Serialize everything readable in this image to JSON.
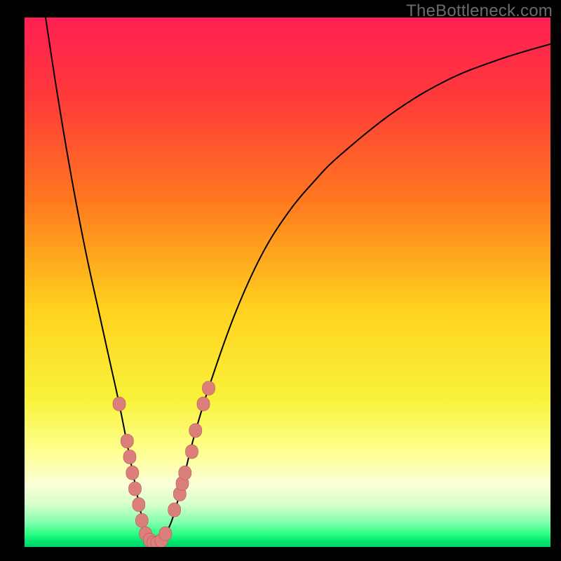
{
  "watermark": "TheBottleneck.com",
  "gradient_stops": [
    {
      "offset": 0.0,
      "color": "#ff1f53"
    },
    {
      "offset": 0.15,
      "color": "#ff3a3a"
    },
    {
      "offset": 0.35,
      "color": "#ff7a1f"
    },
    {
      "offset": 0.55,
      "color": "#ffd21e"
    },
    {
      "offset": 0.72,
      "color": "#f9f23a"
    },
    {
      "offset": 0.82,
      "color": "#feff8f"
    },
    {
      "offset": 0.88,
      "color": "#fbffd7"
    },
    {
      "offset": 0.92,
      "color": "#d6ffca"
    },
    {
      "offset": 0.955,
      "color": "#7dffad"
    },
    {
      "offset": 0.975,
      "color": "#2cff84"
    },
    {
      "offset": 0.99,
      "color": "#00e46f"
    },
    {
      "offset": 1.0,
      "color": "#00d469"
    }
  ],
  "chart_data": {
    "type": "line",
    "title": "",
    "xlabel": "",
    "ylabel": "",
    "xlim": [
      0,
      100
    ],
    "ylim": [
      0,
      100
    ],
    "legend": false,
    "grid": false,
    "series": [
      {
        "name": "curve",
        "x": [
          4,
          6,
          8,
          10,
          12,
          14,
          16,
          18,
          20,
          21,
          22,
          23,
          24,
          25,
          26,
          28,
          30,
          32,
          35,
          40,
          45,
          50,
          55,
          60,
          70,
          80,
          90,
          100
        ],
        "y": [
          100,
          87,
          75,
          64,
          54,
          45,
          36,
          27,
          17,
          12,
          7,
          3,
          1,
          0,
          1,
          5,
          12,
          20,
          30,
          44,
          55,
          63,
          69,
          74,
          82,
          88,
          92,
          95
        ],
        "color": "#000000",
        "linewidth": 2
      }
    ],
    "markers": [
      {
        "name": "pink-dots",
        "shape": "rounded-rect",
        "fill": "#db7f7d",
        "stroke": "#b85855",
        "points": [
          {
            "x": 18.0,
            "y": 27
          },
          {
            "x": 19.5,
            "y": 20
          },
          {
            "x": 20.0,
            "y": 17
          },
          {
            "x": 20.5,
            "y": 14
          },
          {
            "x": 21.0,
            "y": 11
          },
          {
            "x": 21.7,
            "y": 8
          },
          {
            "x": 22.3,
            "y": 5
          },
          {
            "x": 23.0,
            "y": 2.5
          },
          {
            "x": 23.8,
            "y": 1.3
          },
          {
            "x": 24.5,
            "y": 0.8
          },
          {
            "x": 25.2,
            "y": 0.7
          },
          {
            "x": 26.0,
            "y": 1.2
          },
          {
            "x": 26.8,
            "y": 2.5
          },
          {
            "x": 28.5,
            "y": 7
          },
          {
            "x": 29.5,
            "y": 10
          },
          {
            "x": 30.0,
            "y": 12
          },
          {
            "x": 30.5,
            "y": 14
          },
          {
            "x": 31.8,
            "y": 18
          },
          {
            "x": 32.5,
            "y": 22
          },
          {
            "x": 34.0,
            "y": 27
          },
          {
            "x": 35.0,
            "y": 30
          }
        ]
      }
    ]
  }
}
